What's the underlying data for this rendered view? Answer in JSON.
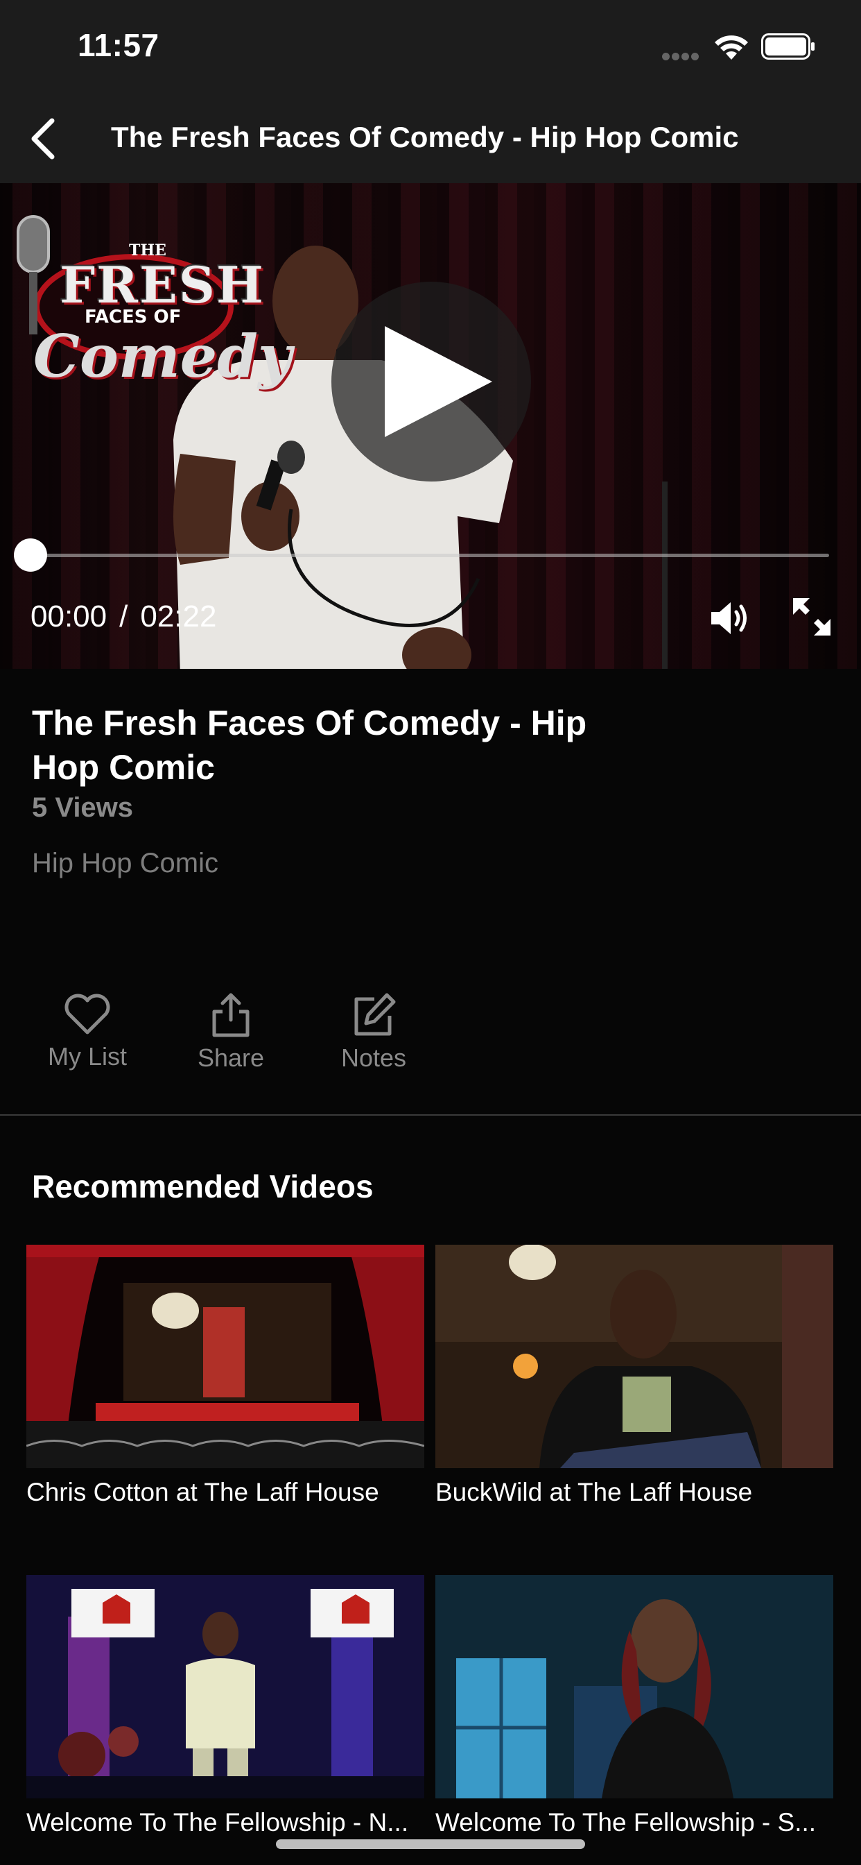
{
  "status_bar": {
    "time": "11:57",
    "icons": [
      "signal-dots-icon",
      "wifi-icon",
      "battery-icon"
    ]
  },
  "nav": {
    "back_icon": "chevron-left-icon",
    "title": "The Fresh Faces Of Comedy - Hip Hop Comic"
  },
  "player": {
    "logo_text": {
      "the": "THE",
      "fresh": "FRESH",
      "faces": "FACES OF",
      "comedy": "Comedy"
    },
    "current_time": "00:00",
    "separator": "/",
    "duration": "02:22",
    "progress_fraction": 0,
    "icons": {
      "play": "play-icon",
      "volume": "volume-icon",
      "fullscreen": "fullscreen-icon"
    }
  },
  "video": {
    "title": "The Fresh Faces Of Comedy - Hip Hop Comic",
    "views": "5 Views",
    "description": "Hip Hop Comic"
  },
  "actions": [
    {
      "label": "My List",
      "icon": "heart-icon"
    },
    {
      "label": "Share",
      "icon": "share-icon"
    },
    {
      "label": "Notes",
      "icon": "edit-icon"
    }
  ],
  "recommended": {
    "heading": "Recommended Videos",
    "items": [
      {
        "title": "Chris Cotton at The Laff House"
      },
      {
        "title": "BuckWild at The Laff House"
      },
      {
        "title": "Welcome To The Fellowship - N..."
      },
      {
        "title": "Welcome To The Fellowship - S..."
      }
    ]
  },
  "colors": {
    "background": "#060606",
    "bar_background": "#1c1c1c",
    "muted_text": "#8a8a8a",
    "divider": "#3a3a3a"
  }
}
